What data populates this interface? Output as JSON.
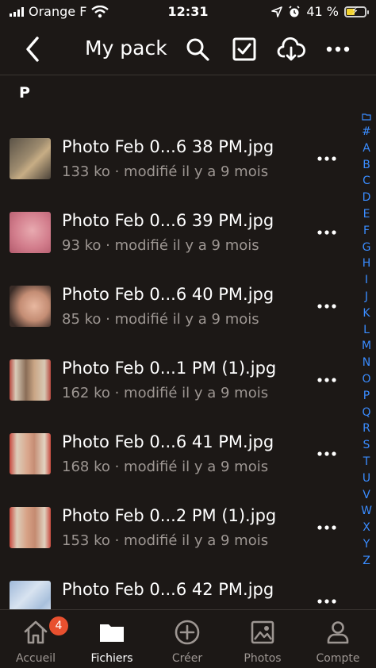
{
  "status_bar": {
    "carrier": "Orange F",
    "time": "12:31",
    "battery": "41 %"
  },
  "header": {
    "title": "My pack"
  },
  "section_letter": "P",
  "files": [
    {
      "name": "Photo Feb 0...6 38 PM.jpg",
      "meta": "133 ko · modifié il y a 9 mois"
    },
    {
      "name": "Photo Feb 0...6 39 PM.jpg",
      "meta": "93 ko · modifié il y a 9 mois"
    },
    {
      "name": "Photo Feb 0...6 40 PM.jpg",
      "meta": "85 ko · modifié il y a 9 mois"
    },
    {
      "name": "Photo Feb 0...1 PM (1).jpg",
      "meta": "162 ko · modifié il y a 9 mois"
    },
    {
      "name": "Photo Feb 0...6 41 PM.jpg",
      "meta": "168 ko · modifié il y a 9 mois"
    },
    {
      "name": "Photo Feb 0...2 PM (1).jpg",
      "meta": "153 ko · modifié il y a 9 mois"
    },
    {
      "name": "Photo Feb 0...6 42 PM.jpg",
      "meta": ""
    }
  ],
  "alpha_index": [
    "#",
    "A",
    "B",
    "C",
    "D",
    "E",
    "F",
    "G",
    "H",
    "I",
    "J",
    "K",
    "L",
    "M",
    "N",
    "O",
    "P",
    "Q",
    "R",
    "S",
    "T",
    "U",
    "V",
    "W",
    "X",
    "Y",
    "Z"
  ],
  "tabs": [
    {
      "label": "Accueil",
      "badge": "4"
    },
    {
      "label": "Fichiers"
    },
    {
      "label": "Créer"
    },
    {
      "label": "Photos"
    },
    {
      "label": "Compte"
    }
  ],
  "colors": {
    "background": "#1c1816",
    "accent": "#3a8cff",
    "badge": "#e8502f",
    "secondary_text": "#9d9692"
  }
}
